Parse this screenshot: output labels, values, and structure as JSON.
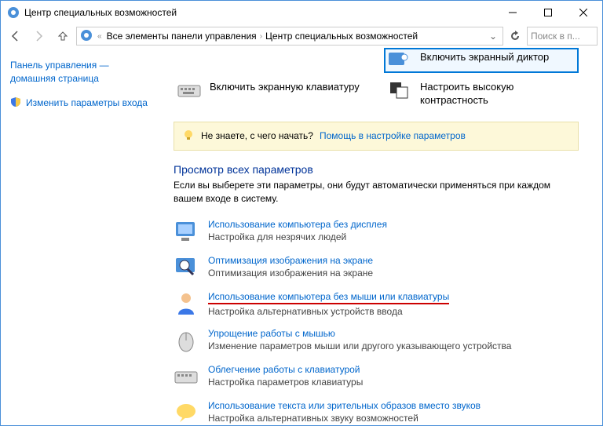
{
  "window": {
    "title": "Центр специальных возможностей"
  },
  "breadcrumb": {
    "item1": "Все элементы панели управления",
    "item2": "Центр специальных возможностей"
  },
  "search": {
    "placeholder": "Поиск в п..."
  },
  "sidebar": {
    "home": "Панель управления — домашняя страница",
    "login": "Изменить параметры входа"
  },
  "quick": {
    "narrator": "Включить экранный диктор",
    "keyboard": "Включить экранную клавиатуру",
    "contrast": "Настроить высокую контрастность"
  },
  "help": {
    "prefix": "Не знаете, с чего начать?",
    "link": "Помощь в настройке параметров"
  },
  "section": {
    "title": "Просмотр всех параметров",
    "desc": "Если вы выберете эти параметры, они будут автоматически применяться при каждом вашем входе в систему."
  },
  "settings": [
    {
      "title": "Использование компьютера без дисплея",
      "sub": "Настройка для незрячих людей"
    },
    {
      "title": "Оптимизация изображения на экране",
      "sub": "Оптимизация изображения на экране"
    },
    {
      "title": "Использование компьютера без мыши или клавиатуры",
      "sub": "Настройка альтернативных устройств ввода"
    },
    {
      "title": "Упрощение работы с мышью",
      "sub": "Изменение параметров мыши или другого указывающего устройства"
    },
    {
      "title": "Облегчение работы с клавиатурой",
      "sub": "Настройка параметров клавиатуры"
    },
    {
      "title": "Использование текста или зрительных образов вместо звуков",
      "sub": "Настройка альтернативных звуку возможностей"
    }
  ]
}
